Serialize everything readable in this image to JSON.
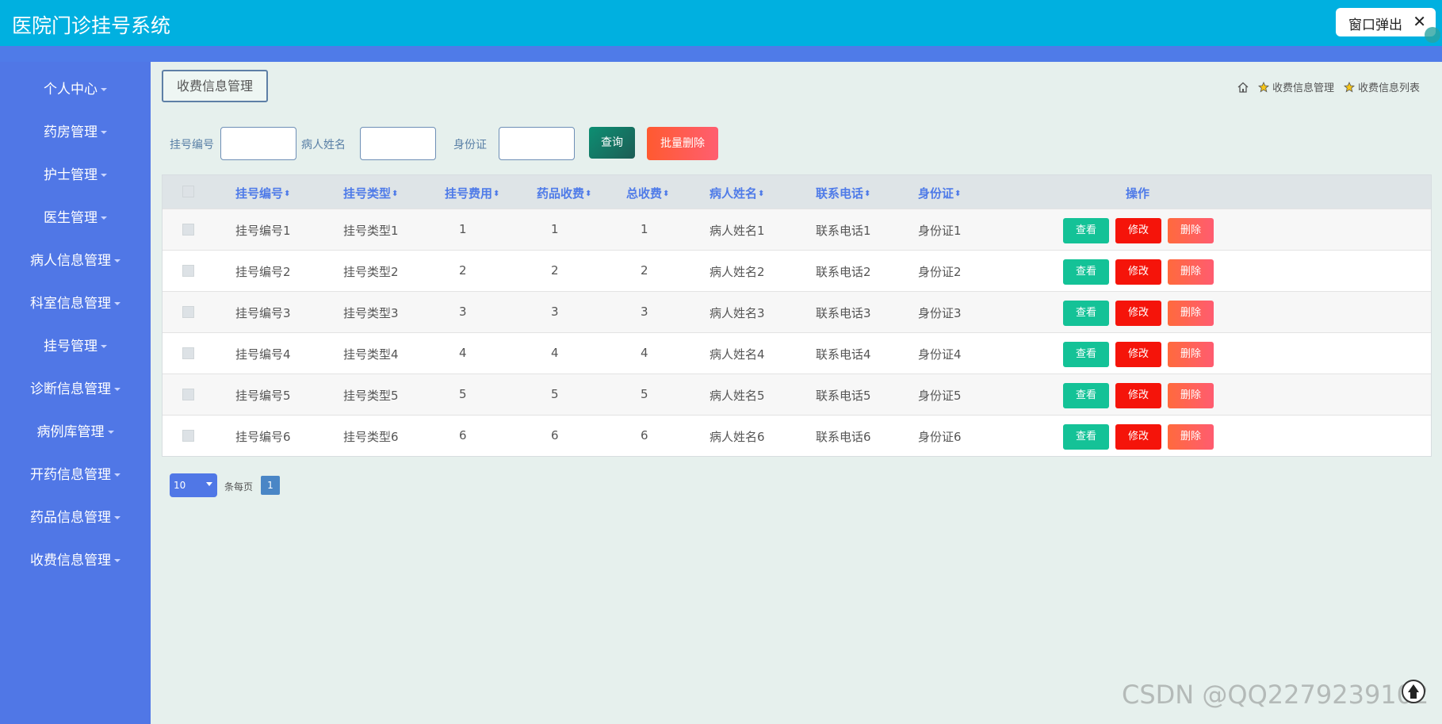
{
  "app": {
    "title": "医院门诊挂号系统"
  },
  "popup_button": {
    "label": "窗口弹出",
    "close": "✕"
  },
  "sidebar": {
    "items": [
      {
        "label": "个人中心"
      },
      {
        "label": "药房管理"
      },
      {
        "label": "护士管理"
      },
      {
        "label": "医生管理"
      },
      {
        "label": "病人信息管理"
      },
      {
        "label": "科室信息管理"
      },
      {
        "label": "挂号管理"
      },
      {
        "label": "诊断信息管理"
      },
      {
        "label": "病例库管理"
      },
      {
        "label": "开药信息管理"
      },
      {
        "label": "药品信息管理"
      },
      {
        "label": "收费信息管理"
      }
    ]
  },
  "page_tab": {
    "label": "收费信息管理"
  },
  "breadcrumb": {
    "level1": "收费信息管理",
    "level2": "收费信息列表"
  },
  "search": {
    "field1_label": "挂号编号",
    "field1_value": "",
    "field2_label": "病人姓名",
    "field2_value": "",
    "field3_label": "身份证",
    "field3_value": "",
    "query_label": "查询",
    "batch_delete_label": "批量删除"
  },
  "table": {
    "headers": [
      "挂号编号",
      "挂号类型",
      "挂号费用",
      "药品收费",
      "总收费",
      "病人姓名",
      "联系电话",
      "身份证"
    ],
    "action_header": "操作",
    "sort_glyph": "⬍",
    "actions": {
      "view": "查看",
      "edit": "修改",
      "delete": "删除"
    },
    "rows": [
      [
        "挂号编号1",
        "挂号类型1",
        "1",
        "1",
        "1",
        "病人姓名1",
        "联系电话1",
        "身份证1"
      ],
      [
        "挂号编号2",
        "挂号类型2",
        "2",
        "2",
        "2",
        "病人姓名2",
        "联系电话2",
        "身份证2"
      ],
      [
        "挂号编号3",
        "挂号类型3",
        "3",
        "3",
        "3",
        "病人姓名3",
        "联系电话3",
        "身份证3"
      ],
      [
        "挂号编号4",
        "挂号类型4",
        "4",
        "4",
        "4",
        "病人姓名4",
        "联系电话4",
        "身份证4"
      ],
      [
        "挂号编号5",
        "挂号类型5",
        "5",
        "5",
        "5",
        "病人姓名5",
        "联系电话5",
        "身份证5"
      ],
      [
        "挂号编号6",
        "挂号类型6",
        "6",
        "6",
        "6",
        "病人姓名6",
        "联系电话6",
        "身份证6"
      ]
    ]
  },
  "pagination": {
    "page_size": "10",
    "per_page_label": "条每页",
    "current_page": "1"
  },
  "watermark": "CSDN @QQ2279239102",
  "colors": {
    "topbar": "#00b0e0",
    "sidebar": "#5077e6",
    "header_text": "#4f7be8",
    "view": "#14c297",
    "edit": "#f5140a",
    "delete": "#ff5e5e"
  }
}
